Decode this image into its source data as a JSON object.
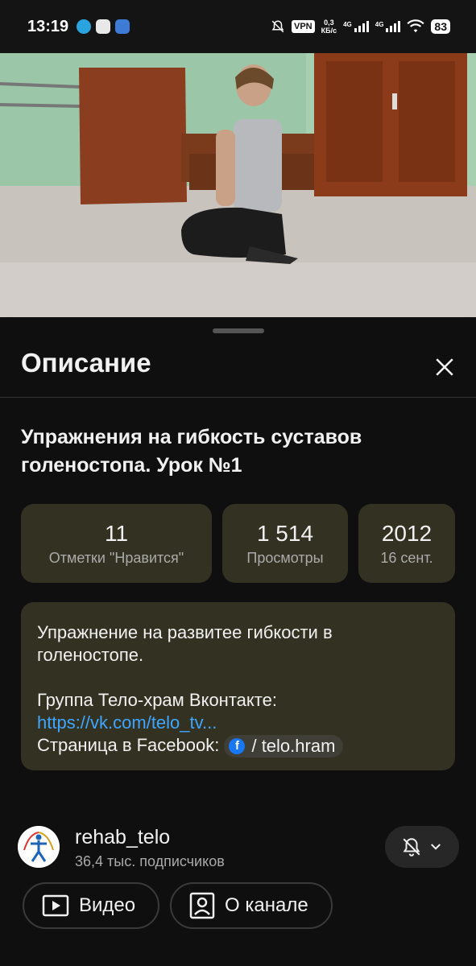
{
  "status_bar": {
    "time": "13:19",
    "vpn": "VPN",
    "speed_value": "0,3",
    "speed_unit": "КБ/с",
    "net1": "4G",
    "net2": "4G",
    "battery": "83"
  },
  "video": {
    "description": "Man kneeling on floor in a room with a piano and wooden doors"
  },
  "sheet": {
    "title": "Описание",
    "video_title": "Упражнения на гибкость суставов голеностопа. Урок №1",
    "stats": [
      {
        "value": "11",
        "label": "Отметки \"Нравится\""
      },
      {
        "value": "1 514",
        "label": "Просмотры"
      },
      {
        "value": "2012",
        "label": "16 сент."
      }
    ],
    "description": {
      "line1": "Упражнение на развитее гибкости в голеностопе.",
      "group_prefix": "Группа Тело-храм Вконтакте: ",
      "group_link": "https://vk.com/telo_tv...",
      "fb_prefix": "Страница в Facebook: ",
      "fb_chip": "/ telo.hram"
    },
    "channel": {
      "name": "rehab_telo",
      "subscribers": "36,4 тыс. подписчиков"
    },
    "buttons": {
      "videos": "Видео",
      "about": "О канале"
    }
  },
  "colors": {
    "background": "#0f0f0f",
    "card": "#333222",
    "link": "#3ea6ff"
  }
}
